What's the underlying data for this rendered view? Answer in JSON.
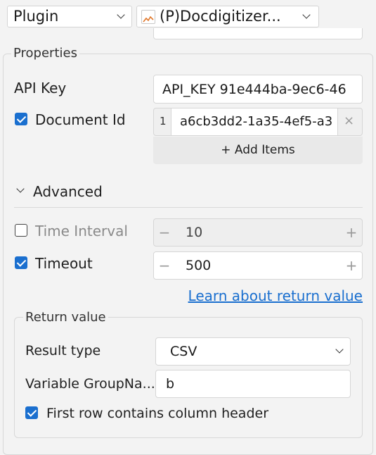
{
  "header": {
    "category_select": "Plugin",
    "plugin_select": "(P)Docdigitizer..."
  },
  "properties": {
    "section_title": "Properties",
    "api_key": {
      "label": "API Key",
      "value": "API_KEY 91e444ba-9ec6-46"
    },
    "document_id": {
      "label": "Document Id",
      "checked": true,
      "item_index": "1",
      "item_value": "a6cb3dd2-1a35-4ef5-a3",
      "add_items_label": "+ Add Items"
    },
    "advanced": {
      "label": "Advanced",
      "expanded": true
    },
    "time_interval": {
      "label": "Time Interval",
      "checked": false,
      "value": "10"
    },
    "timeout": {
      "label": "Timeout",
      "checked": true,
      "value": "500"
    },
    "learn_link": "Learn about return value",
    "return_value": {
      "title": "Return value",
      "result_type_label": "Result type",
      "result_type_value": "CSV",
      "variable_label": "Variable GroupNa...",
      "variable_value": "b",
      "first_row_label": "First row contains column header",
      "first_row_checked": true
    }
  },
  "colors": {
    "accent": "#1a6fcf",
    "background": "#f3f3f3"
  }
}
